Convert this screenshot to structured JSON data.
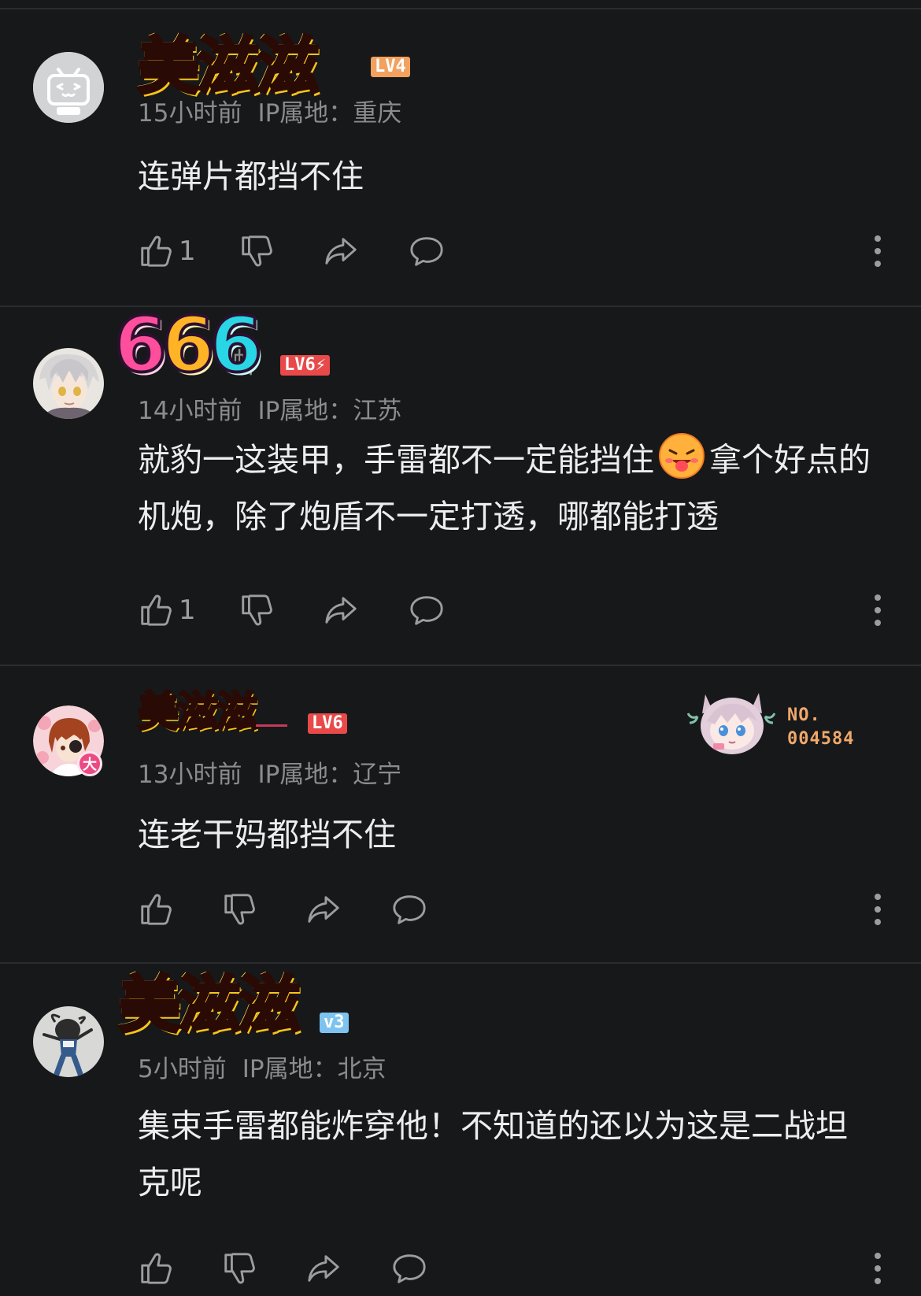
{
  "colors": {
    "background": "#17181a",
    "divider": "#2b2c2f",
    "text_primary": "#ededed",
    "text_secondary": "#8c8c8e",
    "icon": "#9d9da0",
    "level_4": "#f2a25e",
    "level_6": "#e84a4a",
    "level_3": "#7ec3f0"
  },
  "comments": [
    {
      "username": "",
      "name_sticker": "美滋滋",
      "level": "LV4",
      "time": "15小时前",
      "ip": "IP属地：重庆",
      "text": "连弹片都挡不住",
      "like_count": "1",
      "avatar_icon": "default-tv-avatar-icon"
    },
    {
      "username": "虾",
      "name_sticker": "666",
      "level": "LV6⚡",
      "time": "14小时前",
      "ip": "IP属地：江苏",
      "text_before_emoji": "就豹一这装甲，手雷都不一定能挡住",
      "text_after_emoji": "拿个好点的机炮，除了炮盾不一定打透，哪都能打透",
      "emoji_icon": "tongue-out-face-icon",
      "like_count": "1",
      "avatar_icon": "anime-silver-hair-avatar-icon"
    },
    {
      "username": "",
      "name_sticker": "美滋滋",
      "level": "LV6",
      "time": "13小时前",
      "ip": "IP属地：辽宁",
      "text": "连老干妈都挡不住",
      "like_count": "",
      "avatar_icon": "anime-red-hair-avatar-icon",
      "avatar_badge": "大",
      "fan_badge_label": "NO.",
      "fan_badge_number": "004584"
    },
    {
      "username": "",
      "name_sticker": "美滋滋",
      "level": "v3",
      "time": "5小时前",
      "ip": "IP属地：北京",
      "text": "集束手雷都能炸穿他！不知道的还以为这是二战坦克呢",
      "like_count": "",
      "avatar_icon": "photo-person-jumping-avatar-icon"
    }
  ]
}
